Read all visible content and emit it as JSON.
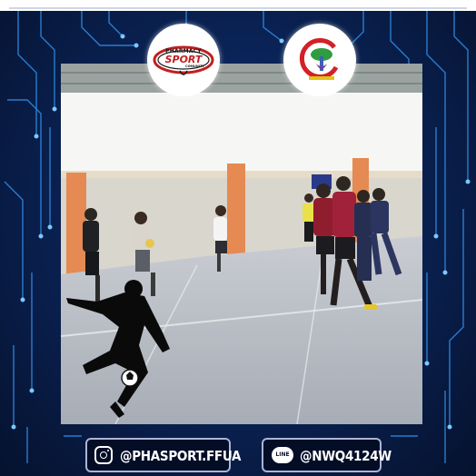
{
  "logos": {
    "left": {
      "name": "Pharmacy Sport Community",
      "line1": "PHARMACY",
      "line2": "SPORT",
      "line3": "COMUNITY"
    },
    "right": {
      "name": "Faculty emblem"
    }
  },
  "social": {
    "instagram": {
      "icon": "instagram-icon",
      "handle": "@PHASPORT.FFUA"
    },
    "line": {
      "icon": "line-icon",
      "icon_text": "LINE",
      "handle": "@NWQ4124W"
    }
  },
  "colors": {
    "background": "#06122e",
    "circuit": "#2f8ee8",
    "accent_red": "#c21f1f"
  }
}
